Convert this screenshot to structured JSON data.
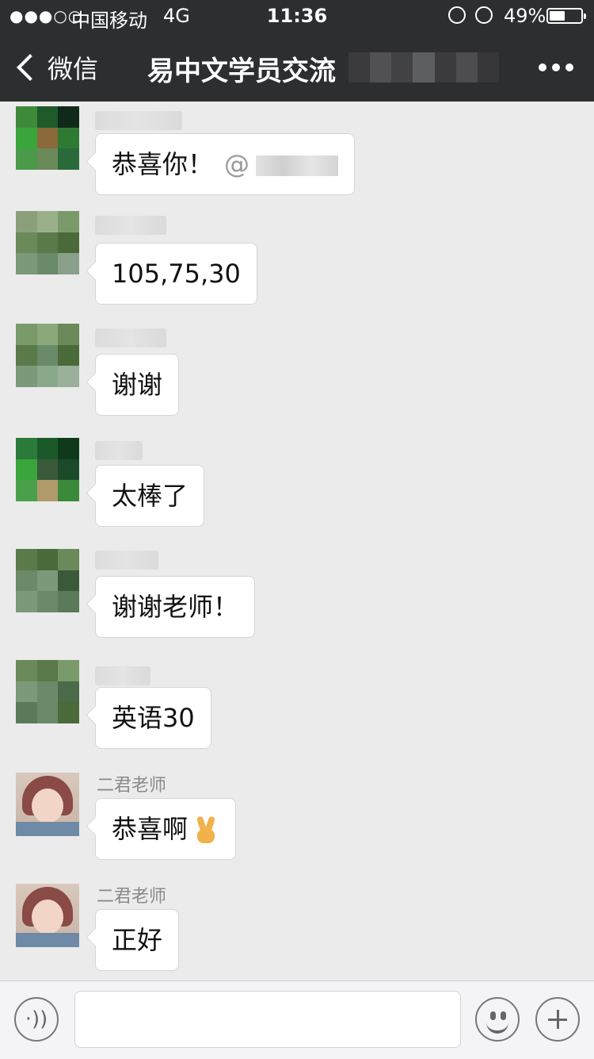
{
  "status_bar": {
    "signal": "●●●○○",
    "carrier": "中国移动",
    "network": "4G",
    "time": "11:36",
    "battery_pct": "49%",
    "battery_level": 0.49
  },
  "nav": {
    "back_label": "微信",
    "title": "易中文学员交流",
    "more_icon": "ellipsis-icon"
  },
  "messages": [
    {
      "sender": "",
      "text": "恭喜你！",
      "mention": "@"
    },
    {
      "sender": "",
      "text": "105,75,30"
    },
    {
      "sender": "",
      "text": "谢谢"
    },
    {
      "sender": "",
      "text": "太棒了"
    },
    {
      "sender": "",
      "text": "谢谢老师！"
    },
    {
      "sender": "",
      "text": "英语30"
    },
    {
      "sender": "二君老师",
      "text": "恭喜啊",
      "emoji": "victory-hand-icon"
    },
    {
      "sender": "二君老师",
      "text": "正好"
    }
  ],
  "input_bar": {
    "voice_icon": "voice-icon",
    "voice_glyph": "·))",
    "emoji_icon": "smiley-icon",
    "plus_icon": "plus-icon"
  },
  "colors": {
    "nav_background": "#2d2e30",
    "chat_background": "#ebebeb",
    "bubble": "#ffffff"
  }
}
